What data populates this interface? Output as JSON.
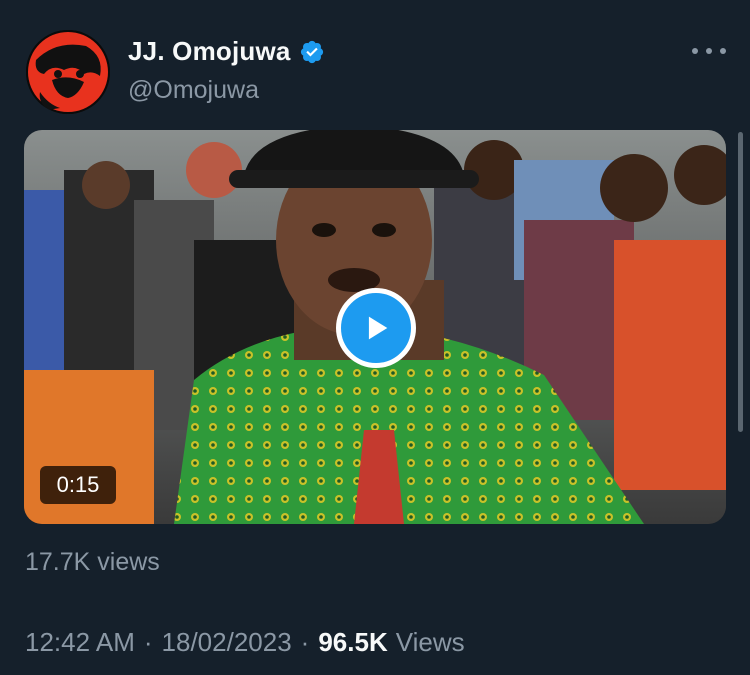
{
  "author": {
    "display_name": "JJ. Omojuwa",
    "handle": "@Omojuwa",
    "verified": true,
    "verified_badge_color": "#1d9bf0"
  },
  "menu": {
    "icon": "more-horizontal-icon"
  },
  "media": {
    "duration": "0:15",
    "view_count_label": "17.7K views",
    "play_icon": "play-icon"
  },
  "meta": {
    "time": "12:42 AM",
    "separator": "·",
    "date": "18/02/2023",
    "views_count": "96.5K",
    "views_label": "Views"
  },
  "colors": {
    "background": "#15202b",
    "primary_text": "#f7f9f9",
    "secondary_text": "#8b98a5",
    "accent": "#1d9bf0"
  }
}
